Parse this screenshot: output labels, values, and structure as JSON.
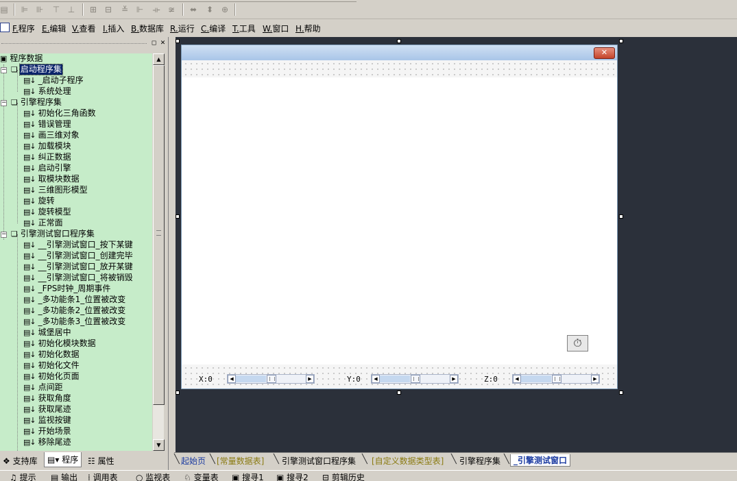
{
  "toolbar": {
    "groups": [
      [
        "align-left-icon",
        "align-center-icon",
        "align-right-icon",
        "align-top-icon"
      ],
      [
        "center-horizontal-icon",
        "center-vertical-icon",
        "align-middle-icon",
        "align-bottom-icon",
        "space-horizontal-icon",
        "space-vertical-icon"
      ],
      [
        "same-width-icon",
        "same-height-icon",
        "same-size-icon"
      ]
    ]
  },
  "menu": {
    "items": [
      {
        "key": "F.",
        "label": "程序"
      },
      {
        "key": "E.",
        "label": "编辑"
      },
      {
        "key": "V.",
        "label": "查看"
      },
      {
        "key": "I.",
        "label": "插入"
      },
      {
        "key": "B.",
        "label": "数据库"
      },
      {
        "key": "R.",
        "label": "运行"
      },
      {
        "key": "C.",
        "label": "编译"
      },
      {
        "key": "T.",
        "label": "工具"
      },
      {
        "key": "W.",
        "label": "窗口"
      },
      {
        "key": "H.",
        "label": "帮助"
      }
    ]
  },
  "tree": {
    "root": "程序数据",
    "groups": [
      {
        "label": "启动程序集",
        "selected": true,
        "items": [
          "_启动子程序",
          "系统处理"
        ]
      },
      {
        "label": "引擎程序集",
        "items": [
          "初始化三角函数",
          "错误管理",
          "画三维对象",
          "加载模块",
          "纠正数据",
          "启动引擎",
          "取模块数据",
          "三维图形模型",
          "旋转",
          "旋转模型",
          "正常面"
        ]
      },
      {
        "label": "引擎测试窗口程序集",
        "items": [
          "__引擎测试窗口_按下某键",
          "__引擎测试窗口_创建完毕",
          "__引擎测试窗口_放开某键",
          "__引擎测试窗口_将被销毁",
          "_FPS时钟_周期事件",
          "_多功能条1_位置被改变",
          "_多功能条2_位置被改变",
          "_多功能条3_位置被改变",
          "城堡居中",
          "初始化模块数据",
          "初始化数据",
          "初始化文件",
          "初始化页面",
          "点间距",
          "获取角度",
          "获取尾迹",
          "监视按键",
          "开始场景",
          "移除尾迹"
        ]
      }
    ]
  },
  "panel_tabs": [
    {
      "label": "支持库",
      "icon": "library-icon"
    },
    {
      "label": "程序",
      "icon": "program-icon",
      "active": true
    },
    {
      "label": "属性",
      "icon": "properties-icon"
    }
  ],
  "form": {
    "axes": [
      {
        "label": "X:0",
        "value": 0.5
      },
      {
        "label": "Y:0",
        "value": 0.5
      },
      {
        "label": "Z:0",
        "value": 0.5
      }
    ]
  },
  "doc_tabs": [
    {
      "label": "起始页",
      "kind": "home"
    },
    {
      "label": "[常量数据表]",
      "kind": "sys"
    },
    {
      "label": "引擎测试窗口程序集",
      "kind": "normal"
    },
    {
      "label": "[自定义数据类型表]",
      "kind": "sys"
    },
    {
      "label": "引擎程序集",
      "kind": "normal"
    },
    {
      "label": "_引擎测试窗口",
      "kind": "active"
    }
  ],
  "bottom_tabs": [
    "提示",
    "输出",
    "调用表",
    "监视表",
    "变量表",
    "搜寻1",
    "搜寻2",
    "剪辑历史"
  ]
}
